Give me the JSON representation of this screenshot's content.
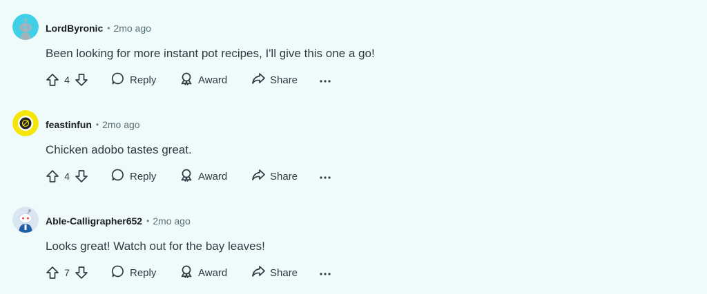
{
  "comments": [
    {
      "username": "LordByronic",
      "separator": "•",
      "time": "2mo ago",
      "body": "Been looking for more instant pot recipes, I'll give this one a go!",
      "votes": "4",
      "avatar": "snoo-avatar-cyan",
      "avatar_color": "#3fd0e8"
    },
    {
      "username": "feastinfun",
      "separator": "•",
      "time": "2mo ago",
      "body": "Chicken adobo tastes great.",
      "votes": "4",
      "avatar": "feastinfun-logo-avatar",
      "avatar_color": "#f5e50b"
    },
    {
      "username": "Able-Calligrapher652",
      "separator": "•",
      "time": "2mo ago",
      "body": "Looks great! Watch out for the bay leaves!",
      "votes": "7",
      "avatar": "snoo-avatar-blue",
      "avatar_color": "#d8e6f2"
    }
  ],
  "actions": {
    "reply_label": "Reply",
    "award_label": "Award",
    "share_label": "Share"
  },
  "icons": {
    "upvote": "upvote-arrow-icon",
    "downvote": "downvote-arrow-icon",
    "reply": "speech-bubble-icon",
    "award": "award-ribbon-icon",
    "share": "share-arrow-icon",
    "more": "more-dots-icon"
  }
}
